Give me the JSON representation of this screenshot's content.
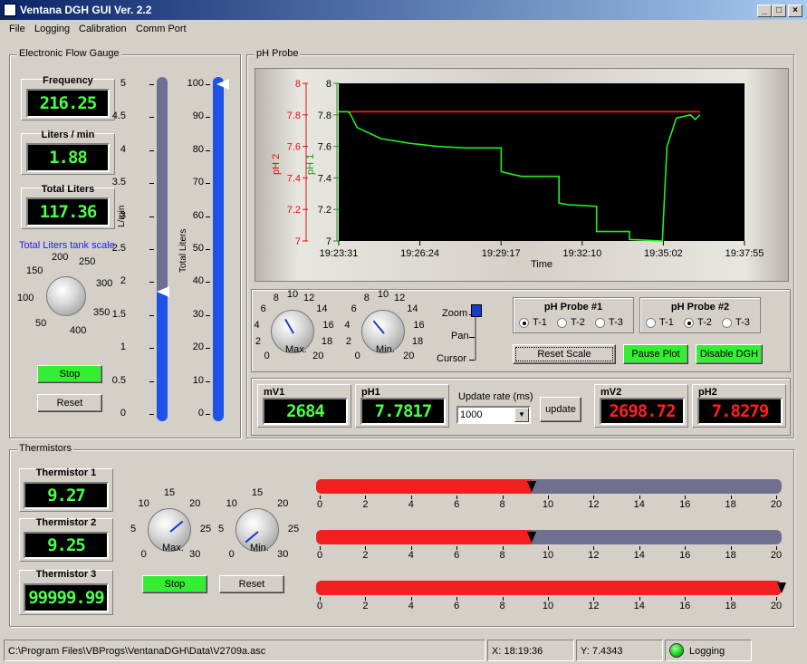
{
  "window": {
    "title": "Ventana DGH GUI  Ver. 2.2"
  },
  "menu": [
    "File",
    "Logging",
    "Calibration",
    "Comm Port"
  ],
  "flow": {
    "title": "Electronic Flow Gauge",
    "frequency_label": "Frequency",
    "frequency_value": "216.25",
    "lpm_label": "Liters / min",
    "lpm_value": "1.88",
    "total_label": "Total Liters",
    "total_value": "117.36",
    "scale_label": "Total Liters tank scale",
    "knob_ticks": [
      "50",
      "100",
      "150",
      "200",
      "250",
      "300",
      "350",
      "400"
    ],
    "stop": "Stop",
    "reset": "Reset",
    "lmin_axis_label": "L/min",
    "lmin_ticks": [
      "5",
      "4.5",
      "4",
      "3.5",
      "3",
      "2.5",
      "2",
      "1.5",
      "1",
      "0.5",
      "0"
    ],
    "lmin_level": 0.376,
    "total_axis_label": "Total Liters",
    "total_ticks": [
      "100",
      "90",
      "80",
      "70",
      "60",
      "50",
      "40",
      "30",
      "20",
      "10",
      "0"
    ],
    "total_level": 1.0
  },
  "ph": {
    "title": "pH Probe",
    "y2_label": "pH 2",
    "y1_label": "pH 1",
    "x_label": "Time",
    "y2_ticks": [
      "8",
      "7.8",
      "7.6",
      "7.4",
      "7.2",
      "7"
    ],
    "y1_ticks": [
      "8",
      "7.8",
      "7.6",
      "7.4",
      "7.2",
      "7"
    ],
    "x_ticks": [
      "19:23:31",
      "19:26:24",
      "19:29:17",
      "19:32:10",
      "19:35:02",
      "19:37:55"
    ],
    "colors": {
      "ph1": "#22ee22",
      "ph2": "#ff2020"
    },
    "knob_ticks": [
      "0",
      "2",
      "4",
      "6",
      "8",
      "10",
      "12",
      "14",
      "16",
      "18",
      "20"
    ],
    "max_label": "Max.",
    "min_label": "Min.",
    "zoom": "Zoom",
    "pan": "Pan",
    "cursor": "Cursor",
    "probe1": {
      "title": "pH Probe #1",
      "options": [
        "T-1",
        "T-2",
        "T-3"
      ],
      "selected": 0
    },
    "probe2": {
      "title": "pH Probe #2",
      "options": [
        "T-1",
        "T-2",
        "T-3"
      ],
      "selected": 1
    },
    "reset_scale": "Reset Scale",
    "pause_plot": "Pause Plot",
    "disable_dgh": "Disable DGH",
    "mv1_label": "mV1",
    "mv1_value": "2684",
    "ph1_label": "pH1",
    "ph1_value": "7.7817",
    "update_rate_label": "Update rate (ms)",
    "update_rate_value": "1000",
    "update": "update",
    "mv2_label": "mV2",
    "mv2_value": "2698.72",
    "ph2_label": "pH2",
    "ph2_value": "7.8279"
  },
  "chart_data": {
    "type": "line",
    "x": [
      "19:23:31",
      "19:23:50",
      "19:23:55",
      "19:24:10",
      "19:25:00",
      "19:26:00",
      "19:27:00",
      "19:28:00",
      "19:29:17",
      "19:29:17",
      "19:29:30",
      "19:30:00",
      "19:30:40",
      "19:31:20",
      "19:31:20",
      "19:31:40",
      "19:32:40",
      "19:32:40",
      "19:33:50",
      "19:33:50",
      "19:35:00",
      "19:35:10",
      "19:35:30",
      "19:36:00",
      "19:36:10",
      "19:36:20"
    ],
    "series": [
      {
        "name": "pH 1",
        "values": [
          7.82,
          7.82,
          7.81,
          7.72,
          7.65,
          7.62,
          7.6,
          7.59,
          7.59,
          7.44,
          7.43,
          7.41,
          7.41,
          7.41,
          7.24,
          7.23,
          7.22,
          7.06,
          7.06,
          7.01,
          7.0,
          7.6,
          7.78,
          7.8,
          7.77,
          7.8
        ]
      },
      {
        "name": "pH 2",
        "values": [
          7.82,
          7.82,
          7.82,
          7.82,
          7.82,
          7.82,
          7.82,
          7.82,
          7.82,
          7.82,
          7.82,
          7.82,
          7.82,
          7.82,
          7.82,
          7.82,
          7.82,
          7.82,
          7.82,
          7.82,
          7.82,
          7.82,
          7.82,
          7.82,
          7.82,
          7.82
        ]
      }
    ],
    "xlabel": "Time",
    "ylabel": "pH 1",
    "ylim": [
      7,
      8
    ]
  },
  "thermistors": {
    "title": "Thermistors",
    "t1_label": "Thermistor 1",
    "t1_value": "9.27",
    "t2_label": "Thermistor 2",
    "t2_value": "9.25",
    "t3_label": "Thermistor 3",
    "t3_value": "99999.99",
    "knob_ticks": [
      "0",
      "5",
      "10",
      "15",
      "20",
      "25",
      "30"
    ],
    "max_label": "Max.",
    "min_label": "Min.",
    "stop": "Stop",
    "reset": "Reset",
    "bar_ticks": [
      "0",
      "2",
      "4",
      "6",
      "8",
      "10",
      "12",
      "14",
      "16",
      "18",
      "20"
    ],
    "bar_values": [
      9.27,
      9.25,
      20
    ],
    "bar_max": 20
  },
  "status": {
    "path": "C:\\Program Files\\VBProgs\\VentanaDGH\\Data\\V2709a.asc",
    "x": "X:  18:19:36",
    "y": "Y:  7.4343",
    "logging": "Logging"
  }
}
